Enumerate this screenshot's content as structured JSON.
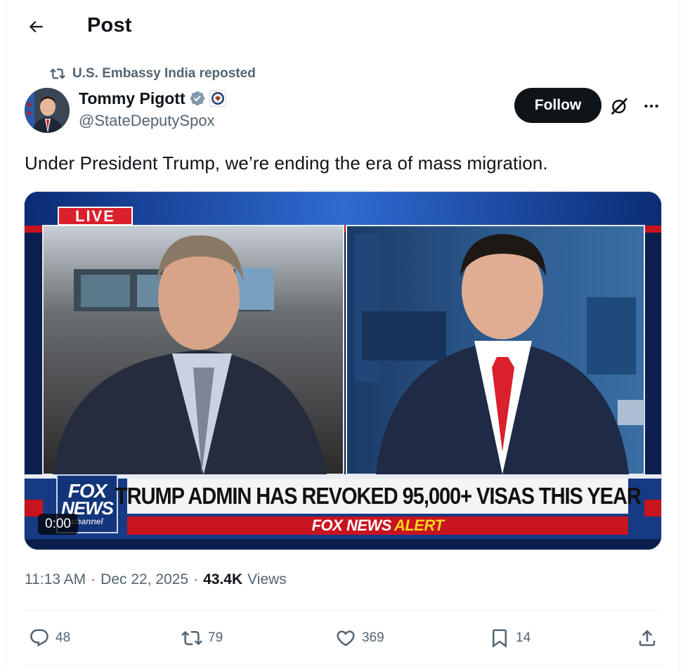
{
  "header": {
    "title": "Post"
  },
  "repost": {
    "label": "U.S. Embassy India reposted"
  },
  "author": {
    "name": "Tommy Pigott",
    "handle": "@StateDeputySpox",
    "verified_color": "#829aab"
  },
  "follow_label": "Follow",
  "post": {
    "text": "Under President Trump, we’re ending the era of mass migration."
  },
  "media": {
    "live_badge": "LIVE",
    "chyron": "TRUMP ADMIN HAS REVOKED 95,000+ VISAS THIS YEAR",
    "alert_brand": "FOX NEWS",
    "alert_word": "ALERT",
    "logo_line1": "FOX",
    "logo_line2": "NEWS",
    "logo_line3": "channel",
    "video_time": "0:00"
  },
  "meta": {
    "time": "11:13 AM",
    "date": "Dec 22, 2025",
    "separator": "·",
    "views_count": "43.4K",
    "views_label": "Views"
  },
  "actions": {
    "replies": "48",
    "reposts": "79",
    "likes": "369",
    "bookmarks": "14"
  },
  "colors": {
    "text_primary": "#0f1419",
    "text_secondary": "#536471",
    "follow_bg": "#0f1419",
    "fox_red": "#c8141e",
    "fox_blue": "#12357a"
  }
}
